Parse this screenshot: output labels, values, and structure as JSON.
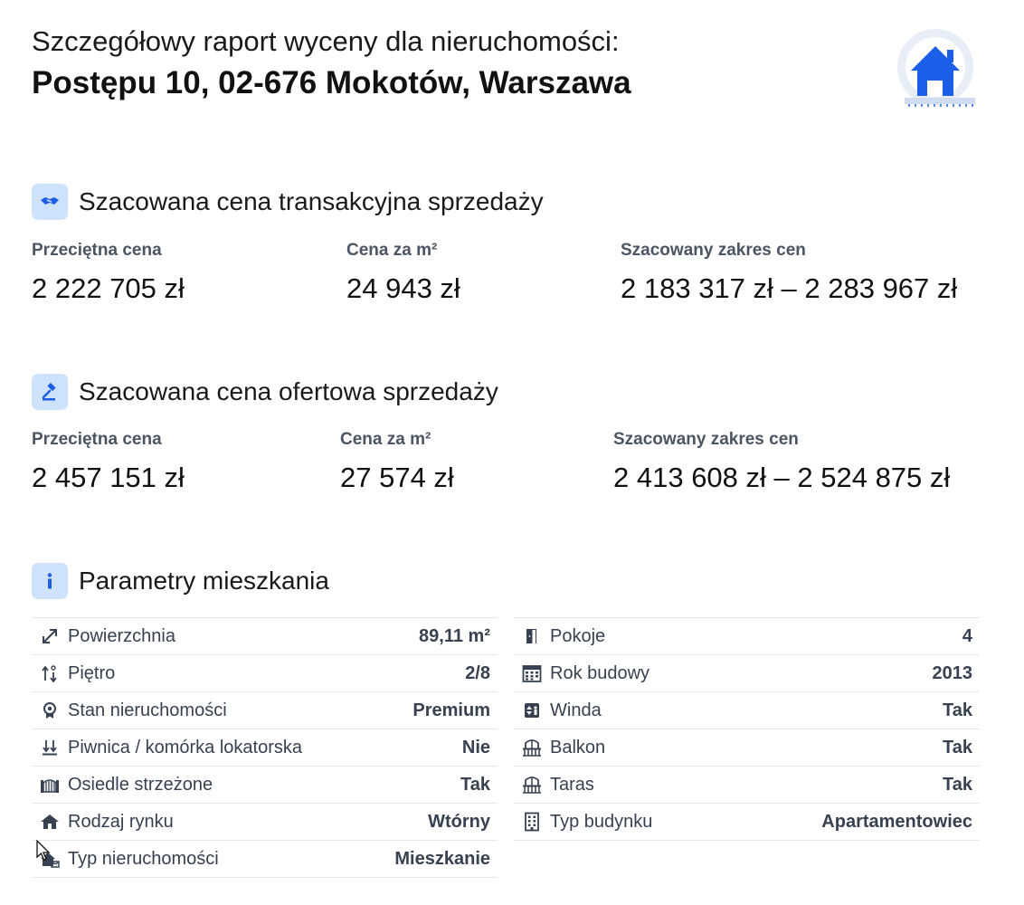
{
  "header": {
    "subtitle": "Szczegółowy raport wyceny dla nieruchomości:",
    "address": "Postępu 10, 02-676 Mokotów, Warszawa",
    "logo_icon": "house-ruler-icon"
  },
  "colors": {
    "accent": "#1d5ee8",
    "icon_bg": "#cfe2fb",
    "text_muted": "#4b5563"
  },
  "transaction": {
    "title": "Szacowana cena transakcyjna sprzedaży",
    "icon": "handshake-icon",
    "avg_label": "Przeciętna cena",
    "avg_value": "2 222 705 zł",
    "sqm_label": "Cena za m²",
    "sqm_value": "24 943 zł",
    "range_label": "Szacowany zakres cen",
    "range_value": "2 183 317 zł – 2 283 967 zł"
  },
  "offer": {
    "title": "Szacowana cena ofertowa sprzedaży",
    "icon": "gavel-icon",
    "avg_label": "Przeciętna cena",
    "avg_value": "2 457 151 zł",
    "sqm_label": "Cena za m²",
    "sqm_value": "27 574 zł",
    "range_label": "Szacowany zakres cen",
    "range_value": "2 413 608 zł – 2 524 875 zł"
  },
  "params": {
    "title": "Parametry mieszkania",
    "icon": "info-icon",
    "left": [
      {
        "label": "Powierzchnia",
        "value": "89,11 m²",
        "icon": "resize-arrow-icon"
      },
      {
        "label": "Piętro",
        "value": "2/8",
        "icon": "floor-icon"
      },
      {
        "label": "Stan nieruchomości",
        "value": "Premium",
        "icon": "award-badge-icon"
      },
      {
        "label": "Piwnica / komórka lokatorska",
        "value": "Nie",
        "icon": "basement-icon"
      },
      {
        "label": "Osiedle strzeżone",
        "value": "Tak",
        "icon": "gate-icon"
      },
      {
        "label": "Rodzaj rynku",
        "value": "Wtórny",
        "icon": "market-house-icon"
      },
      {
        "label": "Typ nieruchomości",
        "value": "Mieszkanie",
        "icon": "property-type-icon"
      }
    ],
    "right": [
      {
        "label": "Pokoje",
        "value": "4",
        "icon": "door-icon"
      },
      {
        "label": "Rok budowy",
        "value": "2013",
        "icon": "calendar-icon"
      },
      {
        "label": "Winda",
        "value": "Tak",
        "icon": "elevator-icon"
      },
      {
        "label": "Balkon",
        "value": "Tak",
        "icon": "balcony-icon"
      },
      {
        "label": "Taras",
        "value": "Tak",
        "icon": "terrace-icon"
      },
      {
        "label": "Typ budynku",
        "value": "Apartamentowiec",
        "icon": "building-icon"
      }
    ]
  }
}
